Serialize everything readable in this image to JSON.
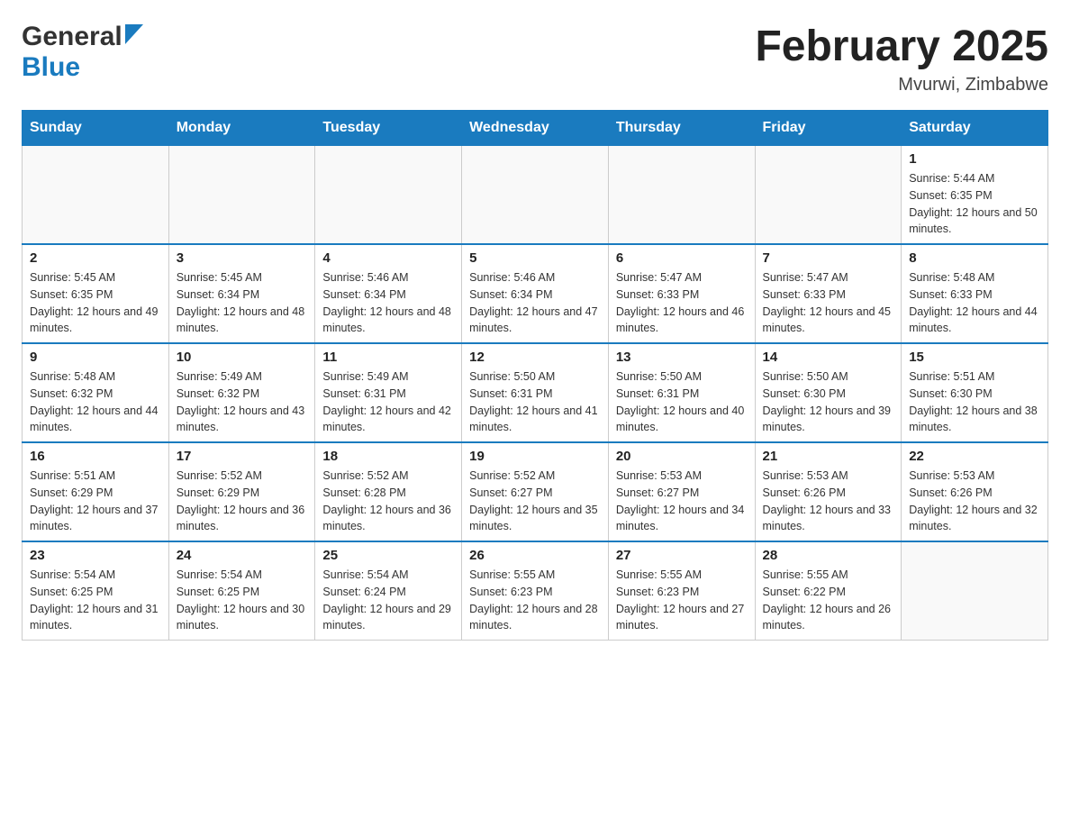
{
  "header": {
    "logo_general": "General",
    "logo_blue": "Blue",
    "month_year": "February 2025",
    "location": "Mvurwi, Zimbabwe"
  },
  "days_of_week": [
    "Sunday",
    "Monday",
    "Tuesday",
    "Wednesday",
    "Thursday",
    "Friday",
    "Saturday"
  ],
  "weeks": [
    [
      {
        "day": "",
        "sunrise": "",
        "sunset": "",
        "daylight": "",
        "empty": true
      },
      {
        "day": "",
        "sunrise": "",
        "sunset": "",
        "daylight": "",
        "empty": true
      },
      {
        "day": "",
        "sunrise": "",
        "sunset": "",
        "daylight": "",
        "empty": true
      },
      {
        "day": "",
        "sunrise": "",
        "sunset": "",
        "daylight": "",
        "empty": true
      },
      {
        "day": "",
        "sunrise": "",
        "sunset": "",
        "daylight": "",
        "empty": true
      },
      {
        "day": "",
        "sunrise": "",
        "sunset": "",
        "daylight": "",
        "empty": true
      },
      {
        "day": "1",
        "sunrise": "Sunrise: 5:44 AM",
        "sunset": "Sunset: 6:35 PM",
        "daylight": "Daylight: 12 hours and 50 minutes.",
        "empty": false
      }
    ],
    [
      {
        "day": "2",
        "sunrise": "Sunrise: 5:45 AM",
        "sunset": "Sunset: 6:35 PM",
        "daylight": "Daylight: 12 hours and 49 minutes.",
        "empty": false
      },
      {
        "day": "3",
        "sunrise": "Sunrise: 5:45 AM",
        "sunset": "Sunset: 6:34 PM",
        "daylight": "Daylight: 12 hours and 48 minutes.",
        "empty": false
      },
      {
        "day": "4",
        "sunrise": "Sunrise: 5:46 AM",
        "sunset": "Sunset: 6:34 PM",
        "daylight": "Daylight: 12 hours and 48 minutes.",
        "empty": false
      },
      {
        "day": "5",
        "sunrise": "Sunrise: 5:46 AM",
        "sunset": "Sunset: 6:34 PM",
        "daylight": "Daylight: 12 hours and 47 minutes.",
        "empty": false
      },
      {
        "day": "6",
        "sunrise": "Sunrise: 5:47 AM",
        "sunset": "Sunset: 6:33 PM",
        "daylight": "Daylight: 12 hours and 46 minutes.",
        "empty": false
      },
      {
        "day": "7",
        "sunrise": "Sunrise: 5:47 AM",
        "sunset": "Sunset: 6:33 PM",
        "daylight": "Daylight: 12 hours and 45 minutes.",
        "empty": false
      },
      {
        "day": "8",
        "sunrise": "Sunrise: 5:48 AM",
        "sunset": "Sunset: 6:33 PM",
        "daylight": "Daylight: 12 hours and 44 minutes.",
        "empty": false
      }
    ],
    [
      {
        "day": "9",
        "sunrise": "Sunrise: 5:48 AM",
        "sunset": "Sunset: 6:32 PM",
        "daylight": "Daylight: 12 hours and 44 minutes.",
        "empty": false
      },
      {
        "day": "10",
        "sunrise": "Sunrise: 5:49 AM",
        "sunset": "Sunset: 6:32 PM",
        "daylight": "Daylight: 12 hours and 43 minutes.",
        "empty": false
      },
      {
        "day": "11",
        "sunrise": "Sunrise: 5:49 AM",
        "sunset": "Sunset: 6:31 PM",
        "daylight": "Daylight: 12 hours and 42 minutes.",
        "empty": false
      },
      {
        "day": "12",
        "sunrise": "Sunrise: 5:50 AM",
        "sunset": "Sunset: 6:31 PM",
        "daylight": "Daylight: 12 hours and 41 minutes.",
        "empty": false
      },
      {
        "day": "13",
        "sunrise": "Sunrise: 5:50 AM",
        "sunset": "Sunset: 6:31 PM",
        "daylight": "Daylight: 12 hours and 40 minutes.",
        "empty": false
      },
      {
        "day": "14",
        "sunrise": "Sunrise: 5:50 AM",
        "sunset": "Sunset: 6:30 PM",
        "daylight": "Daylight: 12 hours and 39 minutes.",
        "empty": false
      },
      {
        "day": "15",
        "sunrise": "Sunrise: 5:51 AM",
        "sunset": "Sunset: 6:30 PM",
        "daylight": "Daylight: 12 hours and 38 minutes.",
        "empty": false
      }
    ],
    [
      {
        "day": "16",
        "sunrise": "Sunrise: 5:51 AM",
        "sunset": "Sunset: 6:29 PM",
        "daylight": "Daylight: 12 hours and 37 minutes.",
        "empty": false
      },
      {
        "day": "17",
        "sunrise": "Sunrise: 5:52 AM",
        "sunset": "Sunset: 6:29 PM",
        "daylight": "Daylight: 12 hours and 36 minutes.",
        "empty": false
      },
      {
        "day": "18",
        "sunrise": "Sunrise: 5:52 AM",
        "sunset": "Sunset: 6:28 PM",
        "daylight": "Daylight: 12 hours and 36 minutes.",
        "empty": false
      },
      {
        "day": "19",
        "sunrise": "Sunrise: 5:52 AM",
        "sunset": "Sunset: 6:27 PM",
        "daylight": "Daylight: 12 hours and 35 minutes.",
        "empty": false
      },
      {
        "day": "20",
        "sunrise": "Sunrise: 5:53 AM",
        "sunset": "Sunset: 6:27 PM",
        "daylight": "Daylight: 12 hours and 34 minutes.",
        "empty": false
      },
      {
        "day": "21",
        "sunrise": "Sunrise: 5:53 AM",
        "sunset": "Sunset: 6:26 PM",
        "daylight": "Daylight: 12 hours and 33 minutes.",
        "empty": false
      },
      {
        "day": "22",
        "sunrise": "Sunrise: 5:53 AM",
        "sunset": "Sunset: 6:26 PM",
        "daylight": "Daylight: 12 hours and 32 minutes.",
        "empty": false
      }
    ],
    [
      {
        "day": "23",
        "sunrise": "Sunrise: 5:54 AM",
        "sunset": "Sunset: 6:25 PM",
        "daylight": "Daylight: 12 hours and 31 minutes.",
        "empty": false
      },
      {
        "day": "24",
        "sunrise": "Sunrise: 5:54 AM",
        "sunset": "Sunset: 6:25 PM",
        "daylight": "Daylight: 12 hours and 30 minutes.",
        "empty": false
      },
      {
        "day": "25",
        "sunrise": "Sunrise: 5:54 AM",
        "sunset": "Sunset: 6:24 PM",
        "daylight": "Daylight: 12 hours and 29 minutes.",
        "empty": false
      },
      {
        "day": "26",
        "sunrise": "Sunrise: 5:55 AM",
        "sunset": "Sunset: 6:23 PM",
        "daylight": "Daylight: 12 hours and 28 minutes.",
        "empty": false
      },
      {
        "day": "27",
        "sunrise": "Sunrise: 5:55 AM",
        "sunset": "Sunset: 6:23 PM",
        "daylight": "Daylight: 12 hours and 27 minutes.",
        "empty": false
      },
      {
        "day": "28",
        "sunrise": "Sunrise: 5:55 AM",
        "sunset": "Sunset: 6:22 PM",
        "daylight": "Daylight: 12 hours and 26 minutes.",
        "empty": false
      },
      {
        "day": "",
        "sunrise": "",
        "sunset": "",
        "daylight": "",
        "empty": true
      }
    ]
  ]
}
